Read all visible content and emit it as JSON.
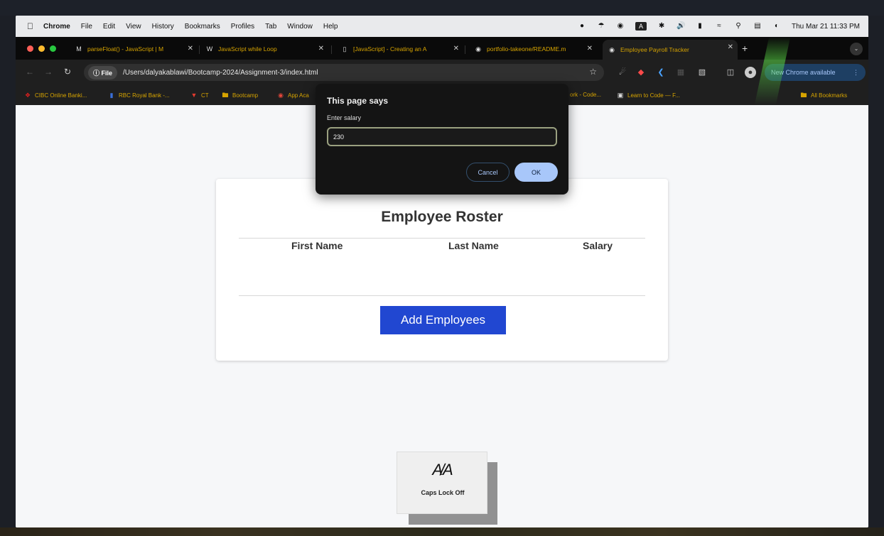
{
  "menubar": {
    "app": "Chrome",
    "items": [
      "File",
      "Edit",
      "View",
      "History",
      "Bookmarks",
      "Profiles",
      "Tab",
      "Window",
      "Help"
    ],
    "datetime": "Thu Mar 21  11:33 PM"
  },
  "tabs": [
    {
      "title": "parseFloat() - JavaScript | M",
      "icon": "mdn-icon"
    },
    {
      "title": "JavaScript while Loop",
      "icon": "w3-icon"
    },
    {
      "title": "[JavaScript] - Creating an A",
      "icon": "doc-icon"
    },
    {
      "title": "portfolio-takeone/README.m",
      "icon": "github-icon"
    },
    {
      "title": "Employee Payroll Tracker",
      "icon": "globe-icon",
      "active": true
    }
  ],
  "toolbar": {
    "chip": "File",
    "url": "/Users/dalyakablawi/Bootcamp-2024/Assignment-3/index.html",
    "update_label": "New Chrome available"
  },
  "bookmarks": [
    {
      "label": "CIBC Online Banki...",
      "icon": "cibc-icon"
    },
    {
      "label": "RBC Royal Bank -...",
      "icon": "rbc-icon"
    },
    {
      "label": "CT",
      "icon": "ct-icon"
    },
    {
      "label": "Bootcamp",
      "icon": "folder-icon"
    },
    {
      "label": "App Aca",
      "icon": "app-icon"
    },
    {
      "label": "ork - Code...",
      "icon": ""
    },
    {
      "label": "Learn to Code — F...",
      "icon": "fcc-icon"
    },
    {
      "label": "All Bookmarks",
      "icon": "folder-icon"
    }
  ],
  "card": {
    "title": "Employee Roster",
    "columns": [
      "First Name",
      "Last Name",
      "Salary"
    ],
    "button": "Add Employees"
  },
  "dialog": {
    "title": "This page says",
    "message": "Enter salary",
    "input_value": "230",
    "cancel": "Cancel",
    "ok": "OK"
  },
  "capslock": {
    "text": "Caps Lock Off"
  }
}
